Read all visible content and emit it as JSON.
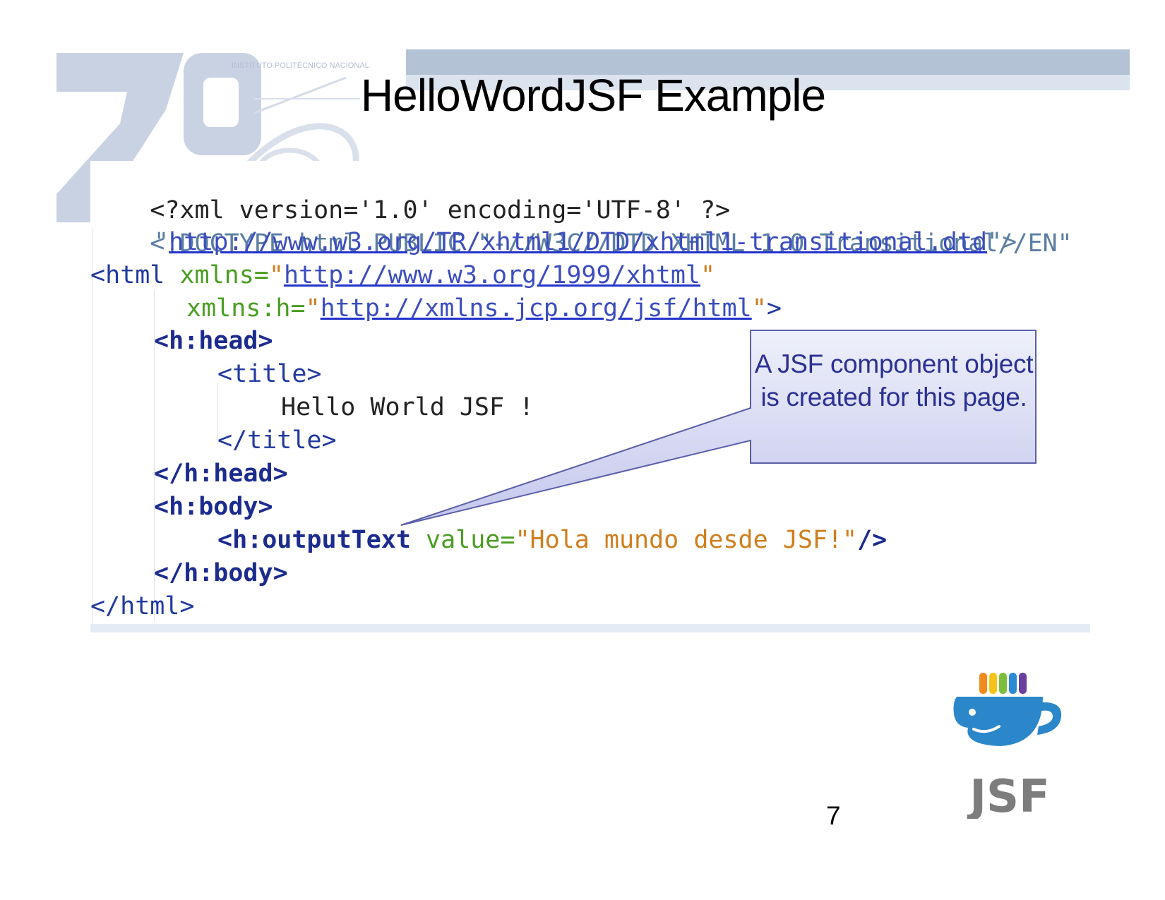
{
  "slide": {
    "title": "HelloWordJSF Example",
    "page_number": "7"
  },
  "watermark": {
    "institution": "INSTITUTO POLITÉCNICO NACIONAL"
  },
  "code": {
    "line1": "<?xml version='1.0' encoding='UTF-8' ?>",
    "line2": "<!DOCTYPE html PUBLIC \"-//W3C//DTD XHTML 1.0 Transitional//EN\"",
    "line3_quote_open": "\"",
    "line3_url": "http://www.w3.org/TR/xhtml1/DTD/xhtml1-transitional.dtd",
    "line3_tail": "\">",
    "line4_tag": "<html ",
    "line4_attr": "xmlns=",
    "line4_quote_open": "\"",
    "line4_url": "http://www.w3.org/1999/xhtml",
    "line4_quote_close": "\"",
    "line5_attr": "xmlns:h=",
    "line5_quote_open": "\"",
    "line5_url": "http://xmlns.jcp.org/jsf/html",
    "line5_quote_close": "\"",
    "line5_tail": ">",
    "line6": "<h:head>",
    "line7": "<title>",
    "line8": "Hello World JSF !",
    "line9": "</title>",
    "line10": "</h:head>",
    "line11": "<h:body>",
    "line12_tag": "<h:outputText",
    "line12_attr": "value=",
    "line12_string": "\"Hola mundo desde JSF!\"",
    "line12_tail": "/>",
    "line13": "</h:body>",
    "line14": "</html>"
  },
  "callout": {
    "text": "A JSF component object is created for this page."
  },
  "logo": {
    "text": "JSF",
    "icon": "jsf-cup-logo-icon",
    "colors": [
      "#f08a1c",
      "#f6c419",
      "#7bbf3a",
      "#2a8ad4",
      "#6a3f9e"
    ],
    "cup_color": "#2b87c9",
    "text_color": "#7d7d7d"
  },
  "colors": {
    "callout_fill_top": "#eef0fb",
    "callout_fill_bottom": "#c4c7ec",
    "callout_border": "#5a5fa8"
  }
}
